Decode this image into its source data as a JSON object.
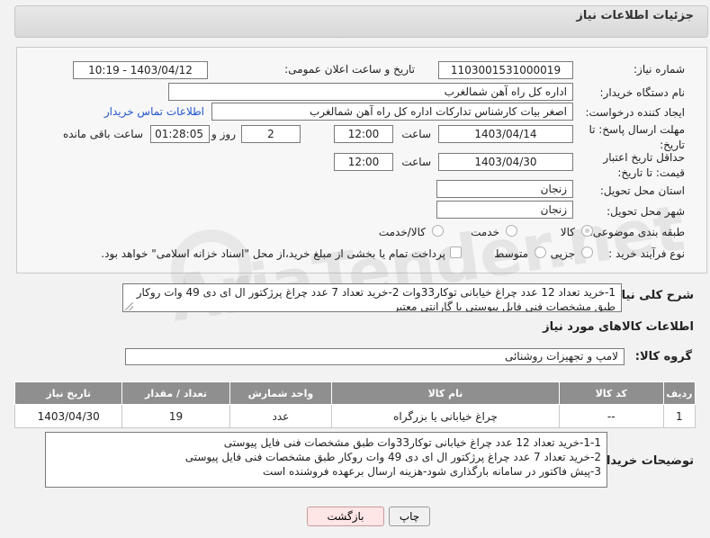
{
  "header": {
    "title": "جزئیات اطلاعات نیاز"
  },
  "form": {
    "need_number": {
      "label": "شماره نیاز:",
      "value": "1103001531000019"
    },
    "announce": {
      "label": "تاریخ و ساعت اعلان عمومی:",
      "value": "1403/04/12 - 10:19"
    },
    "buyer_org": {
      "label": "نام دستگاه خریدار:",
      "value": "اداره کل راه آهن شمالغرب"
    },
    "creator": {
      "label": "ایجاد کننده درخواست:",
      "value": "اصغر بیات کارشناس تدارکات اداره کل راه آهن شمالغرب",
      "link": "اطلاعات تماس خریدار"
    },
    "deadline": {
      "label": "مهلت ارسال پاسخ: تا تاریخ:",
      "date": "1403/04/14",
      "time_label": "ساعت",
      "time": "12:00",
      "days": "2",
      "days_label": "روز و",
      "remaining": "01:28:05",
      "remaining_label": "ساعت باقی مانده"
    },
    "validity": {
      "label": "حداقل تاریخ اعتبار قیمت: تا تاریخ:",
      "date": "1403/04/30",
      "time_label": "ساعت",
      "time": "12:00"
    },
    "province": {
      "label": "استان محل تحویل:",
      "value": "زنجان"
    },
    "city": {
      "label": "شهر محل تحویل:",
      "value": "زنجان"
    },
    "category": {
      "label": "طبقه بندی موضوعی:",
      "options": [
        "کالا",
        "خدمت",
        "کالا/خدمت"
      ],
      "selected": "کالا"
    },
    "process": {
      "label": "نوع فرآیند خرید :",
      "options": [
        "جزیی",
        "متوسط"
      ],
      "note": "پرداخت تمام یا بخشی از مبلغ خرید،از محل \"اسناد خزانه اسلامی\" خواهد بود."
    }
  },
  "description": {
    "label": "شرح کلی نیاز:",
    "value": "1-خرید تعداد 12 عدد چراغ خیابانی  توکار33وات 2-خرید تعداد 7 عدد چراغ پرژکتور ال ای دی 49 وات روکار طبق مشخصات فنی فایل پیوستی با گارانتی معتبر"
  },
  "goods": {
    "section_title": "اطلاعات کالاهای مورد نیاز",
    "group_label": "گروه کالا:",
    "group_value": "لامپ و تجهیزات روشنائی",
    "columns": [
      "ردیف",
      "کد کالا",
      "نام کالا",
      "واحد شمارش",
      "تعداد / مقدار",
      "تاریخ نیاز"
    ],
    "rows": [
      [
        "1",
        "--",
        "چراغ خیابانی یا بزرگراه",
        "عدد",
        "19",
        "1403/04/30"
      ]
    ]
  },
  "buyer_notes": {
    "label": "توضیحات خریدار:",
    "value": "1-1-خرید تعداد 12 عدد چراغ خیابانی  توکار33وات طبق مشخصات فنی فایل  پیوستی\n2-خرید تعداد 7 عدد چراغ پرژکتور ال ای دی 49 وات روکار طبق مشخصات فنی فایل پیوستی\n3-پیش فاکتور در سامانه بارگذاری شود-هزینه ارسال برعهده فروشنده است"
  },
  "buttons": {
    "print": "چاپ",
    "back": "بازگشت"
  },
  "watermark": {
    "text": "AriaTender.net"
  }
}
